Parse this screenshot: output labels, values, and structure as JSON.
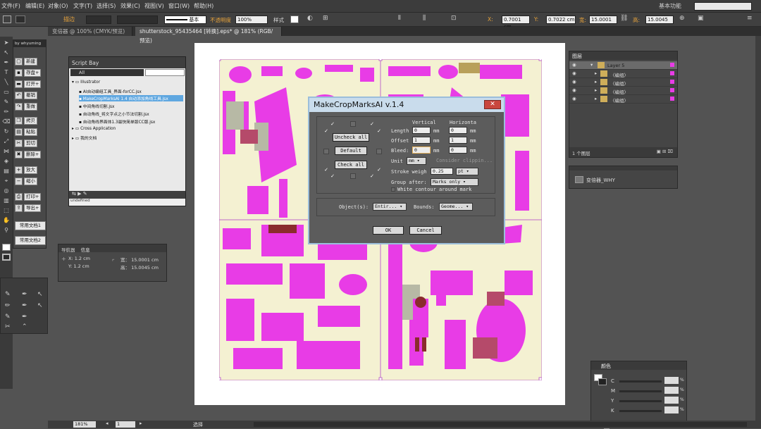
{
  "menu": [
    "文件(F)",
    "编辑(E)",
    "对象(O)",
    "文字(T)",
    "选择(S)",
    "效果(C)",
    "视图(V)",
    "窗口(W)",
    "帮助(H)"
  ],
  "workspace": "基本功能",
  "options": {
    "mode": "描边",
    "stroke_style": "基本",
    "opacity_label": "不透明度",
    "opacity": "100%",
    "style_label": "样式",
    "x_label": "X:",
    "x": "0.7001 cm",
    "y_label": "Y:",
    "y": "0.7022 cm",
    "w_label": "宽:",
    "w": "15.0001",
    "h_label": "高:",
    "h": "15.0045"
  },
  "tabs": [
    "变倍器 @ 100% (CMYK/预览)",
    "shutterstock_95435464 [转换].eps* @ 181% (RGB/预览)"
  ],
  "buttonpanel": {
    "header": "by whyuming",
    "items": [
      "新建",
      "存盘+",
      "打开+",
      "撤销",
      "重做",
      "拷贝",
      "粘贴",
      "剪切",
      "删除+",
      "放大",
      "缩小",
      "打印+",
      "导出+"
    ],
    "wide": [
      "常用文档1",
      "常用文档2"
    ]
  },
  "scriptbay": {
    "title": "Script Bay",
    "filter": "All",
    "tree": [
      "Illustrator",
      "AI自动编组工具_界面-forCC.jsx",
      "MakeCropMarksAI 1.4 自动添加角线工具.jsx",
      "中间角线切割.jsx",
      "自动角线_将文字点之小节法切割.jsx",
      "自动角线界面体1.3最快简单版CC版.jsx",
      "Cross Application",
      "我的文档"
    ],
    "status": "undefined"
  },
  "navigator": {
    "tabs": [
      "导航器",
      "信息"
    ],
    "x": "X: 1.2 cm",
    "y": "Y: 1.2 cm",
    "w": "宽： 15.0001 cm",
    "h": "高： 15.0045 cm"
  },
  "dialog": {
    "title": "MakeCropMarksAI v.1.4",
    "close": "✕",
    "uncheck_all": "Uncheck all",
    "default": "Default",
    "check_all": "Check all",
    "col_vertical": "Vertical",
    "col_horizontal": "Horizonta",
    "length_label": "Length",
    "length_v": "0",
    "length_h": "0",
    "unit_mm": "mm",
    "offset_label": "Offset",
    "offset_v": "1",
    "offset_h": "1",
    "bleed_label": "Bleed:",
    "bleed_v": "0",
    "bleed_h": "0",
    "consider_clipping": "Consider clippin...",
    "unit_label": "Unit",
    "unit": "mm",
    "stroke_label": "Stroke weigh",
    "stroke": "0.25",
    "stroke_unit": "pt",
    "group_label": "Group after:",
    "group": "Marks only",
    "white_contour": "White contour around mark",
    "objects_label": "Object(s):",
    "objects": "Entir...",
    "bounds_label": "Bounds:",
    "bounds": "Geome...",
    "ok": "OK",
    "cancel": "Cancel"
  },
  "layers": {
    "title": "图层",
    "rows": [
      "Layer 5",
      "〈编组〉",
      "〈编组〉",
      "〈编组〉",
      "〈编组〉"
    ],
    "footer": "1 个图层"
  },
  "actions": {
    "item": "变倍器_WHY"
  },
  "color": {
    "title": "颜色",
    "channels": [
      "C",
      "M",
      "Y",
      "K"
    ],
    "unit": "%"
  },
  "status": {
    "zoom": "181%",
    "page": "1",
    "tool": "选择"
  },
  "accent": "#e83ce6"
}
